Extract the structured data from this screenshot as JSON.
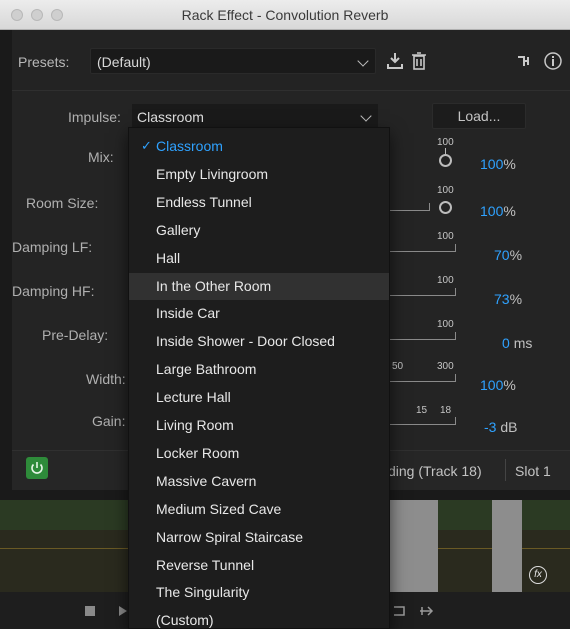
{
  "window": {
    "title": "Rack Effect - Convolution Reverb"
  },
  "presets": {
    "label": "Presets:",
    "value": "(Default)"
  },
  "impulse": {
    "label": "Impulse:",
    "value": "Classroom",
    "load_label": "Load...",
    "options": [
      "Classroom",
      "Empty Livingroom",
      "Endless Tunnel",
      "Gallery",
      "Hall",
      "In the Other Room",
      "Inside Car",
      "Inside Shower - Door Closed",
      "Large Bathroom",
      "Lecture Hall",
      "Living Room",
      "Locker Room",
      "Massive Cavern",
      "Medium Sized Cave",
      "Narrow Spiral Staircase",
      "Reverse Tunnel",
      "The Singularity",
      "(Custom)"
    ],
    "selected_index": 0,
    "hovered_index": 5
  },
  "params": [
    {
      "label": "Mix:",
      "tick": "100",
      "value": "100",
      "unit": "%"
    },
    {
      "label": "Room Size:",
      "tick": "100",
      "value": "100",
      "unit": "%"
    },
    {
      "label": "Damping LF:",
      "tick": "100",
      "value": "70",
      "unit": "%"
    },
    {
      "label": "Damping HF:",
      "tick": "100",
      "value": "73",
      "unit": "%"
    },
    {
      "label": "Pre-Delay:",
      "tick": "100",
      "value": "0",
      "unit": "ms"
    },
    {
      "label": "Width:",
      "tick_a": "50",
      "tick": "300",
      "value": "100",
      "unit": "%"
    },
    {
      "label": "Gain:",
      "tick_a": "15",
      "tick": "18",
      "value": "-3",
      "unit": "dB"
    }
  ],
  "footer": {
    "track_text": "ding (Track 18)",
    "slot_text": "Slot 1"
  },
  "colors": {
    "accent": "#2fa2ff",
    "power": "#2e8b3a",
    "panel": "#232323"
  },
  "icons": [
    "download-icon",
    "trash-icon",
    "routing-icon",
    "info-icon",
    "power-icon",
    "fx-icon",
    "stop-icon",
    "play-icon"
  ]
}
